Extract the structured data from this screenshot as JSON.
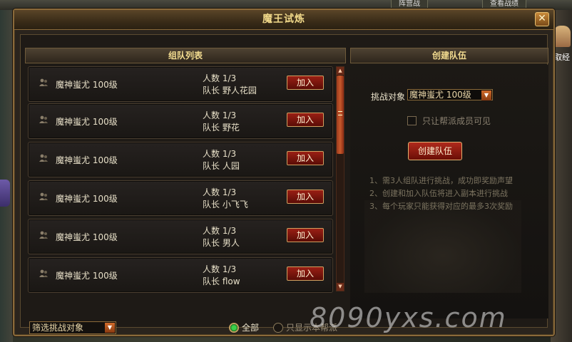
{
  "background": {
    "top_tabs": [
      "阵营战",
      "查看战绩"
    ],
    "side_text": "取经"
  },
  "window": {
    "title": "魔王试炼",
    "close_glyph": "✕"
  },
  "team_list": {
    "header": "组队列表",
    "join_label": "加入",
    "count_prefix": "人数",
    "leader_prefix": "队长",
    "rows": [
      {
        "name": "魔神蚩尤 100级",
        "count": "1/3",
        "leader": "野人花园"
      },
      {
        "name": "魔神蚩尤 100级",
        "count": "1/3",
        "leader": "野花"
      },
      {
        "name": "魔神蚩尤 100级",
        "count": "1/3",
        "leader": "人园"
      },
      {
        "name": "魔神蚩尤 100级",
        "count": "1/3",
        "leader": "小飞飞"
      },
      {
        "name": "魔神蚩尤 100级",
        "count": "1/3",
        "leader": "男人"
      },
      {
        "name": "魔神蚩尤 100级",
        "count": "1/3",
        "leader": "flow"
      }
    ]
  },
  "filter": {
    "select_value": "筛选挑战对象",
    "radio_all": "全部",
    "radio_guild": "只显示本帮派",
    "selected": "all"
  },
  "create_team": {
    "header": "创建队伍",
    "target_label": "挑战对象",
    "target_value": "魔神蚩尤 100级",
    "guild_only_label": "只让帮派成员可见",
    "guild_only_checked": false,
    "create_button": "创建队伍",
    "rules": [
      "1、需3人组队进行挑战，成功即奖励声望",
      "2、创建和加入队伍将进入副本进行挑战",
      "3、每个玩家只能获得对应的最多3次奖励"
    ]
  },
  "watermark": "8090yxs.com",
  "colors": {
    "accent_gold": "#f3dc90",
    "button_red": "#9a1f14",
    "radio_green": "#3ad04a"
  }
}
